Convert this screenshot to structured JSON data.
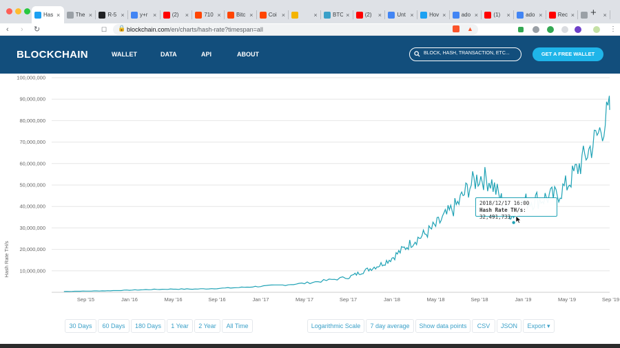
{
  "tabs": [
    {
      "title": "Has",
      "favicon_color": "#1da1f2",
      "active": true
    },
    {
      "title": "The",
      "favicon_color": "#9aa0a6"
    },
    {
      "title": "R-5",
      "favicon_color": "#202124"
    },
    {
      "title": "y+r",
      "favicon_color": "#4285f4"
    },
    {
      "title": "(2)",
      "favicon_color": "#ff0000"
    },
    {
      "title": "710",
      "favicon_color": "#ff4500"
    },
    {
      "title": "Bitc",
      "favicon_color": "#ff4500"
    },
    {
      "title": "Coi",
      "favicon_color": "#ff4500"
    },
    {
      "title": "",
      "favicon_color": "#f4b400"
    },
    {
      "title": "BTC",
      "favicon_color": "#3aa0c8"
    },
    {
      "title": "(2)",
      "favicon_color": "#ff0000"
    },
    {
      "title": "Unt",
      "favicon_color": "#4285f4"
    },
    {
      "title": "Hov",
      "favicon_color": "#1da1f2"
    },
    {
      "title": "ado",
      "favicon_color": "#4285f4"
    },
    {
      "title": "(1)",
      "favicon_color": "#ff0000"
    },
    {
      "title": "ado",
      "favicon_color": "#4285f4"
    },
    {
      "title": "Rec",
      "favicon_color": "#ff0000"
    },
    {
      "title": "",
      "favicon_color": "#9aa0a6"
    }
  ],
  "browser": {
    "url_domain": "blockchain.com",
    "url_path": "/en/charts/hash-rate?timespan=all"
  },
  "site": {
    "logo": "BLOCKCHAIN",
    "nav": [
      "WALLET",
      "DATA",
      "API",
      "ABOUT"
    ],
    "search_placeholder": "BLOCK, HASH, TRANSACTION, ETC...",
    "cta": "GET A FREE WALLET",
    "brand_color": "#124e7c",
    "accent_color": "#1fb5e9"
  },
  "chart_data": {
    "type": "line",
    "ylabel": "Hash Rate TH/s",
    "ylim": [
      0,
      100000000
    ],
    "yticks": [
      "10,000,000",
      "20,000,000",
      "30,000,000",
      "40,000,000",
      "50,000,000",
      "60,000,000",
      "70,000,000",
      "80,000,000",
      "90,000,000",
      "100,000,000"
    ],
    "xticks": [
      "Sep '15",
      "Jan '16",
      "May '16",
      "Sep '16",
      "Jan '17",
      "May '17",
      "Sep '17",
      "Jan '18",
      "May '18",
      "Sep '18",
      "Jan '19",
      "May '19",
      "Sep '19"
    ],
    "line_color": "#1fa2b5",
    "series": [
      {
        "x": [
          "2015-07",
          "2015-09",
          "2015-11",
          "2016-01",
          "2016-03",
          "2016-05",
          "2016-07",
          "2016-09",
          "2016-11",
          "2017-01",
          "2017-03",
          "2017-05",
          "2017-07",
          "2017-09",
          "2017-10",
          "2017-11",
          "2017-12",
          "2018-01",
          "2018-02",
          "2018-03",
          "2018-04",
          "2018-05",
          "2018-06",
          "2018-07",
          "2018-08",
          "2018-09",
          "2018-10",
          "2018-11",
          "2018-12",
          "2019-01",
          "2019-02",
          "2019-03",
          "2019-04",
          "2019-05",
          "2019-06",
          "2019-07",
          "2019-08",
          "2019-09"
        ],
        "values": [
          400000,
          550000,
          700000,
          1000000,
          1300000,
          1500000,
          1500000,
          1800000,
          2200000,
          2800000,
          3400000,
          4200000,
          5500000,
          7000000,
          9000000,
          11000000,
          13000000,
          16000000,
          20000000,
          24000000,
          27000000,
          31000000,
          36000000,
          41000000,
          49000000,
          54000000,
          52000000,
          43000000,
          36000000,
          42000000,
          43000000,
          44000000,
          45000000,
          50000000,
          58000000,
          66000000,
          75000000,
          85000000
        ]
      }
    ],
    "tooltip": {
      "date": "2018/12/17 16:00",
      "label": "Hash Rate TH/s",
      "value": "32,491,733"
    }
  },
  "controls": {
    "timespans": [
      "30 Days",
      "60 Days",
      "180 Days",
      "1 Year",
      "2 Year",
      "All Time"
    ],
    "options": [
      "Logarithmic Scale",
      "7 day average",
      "Show data points",
      "CSV",
      "JSON",
      "Export ▾"
    ]
  }
}
